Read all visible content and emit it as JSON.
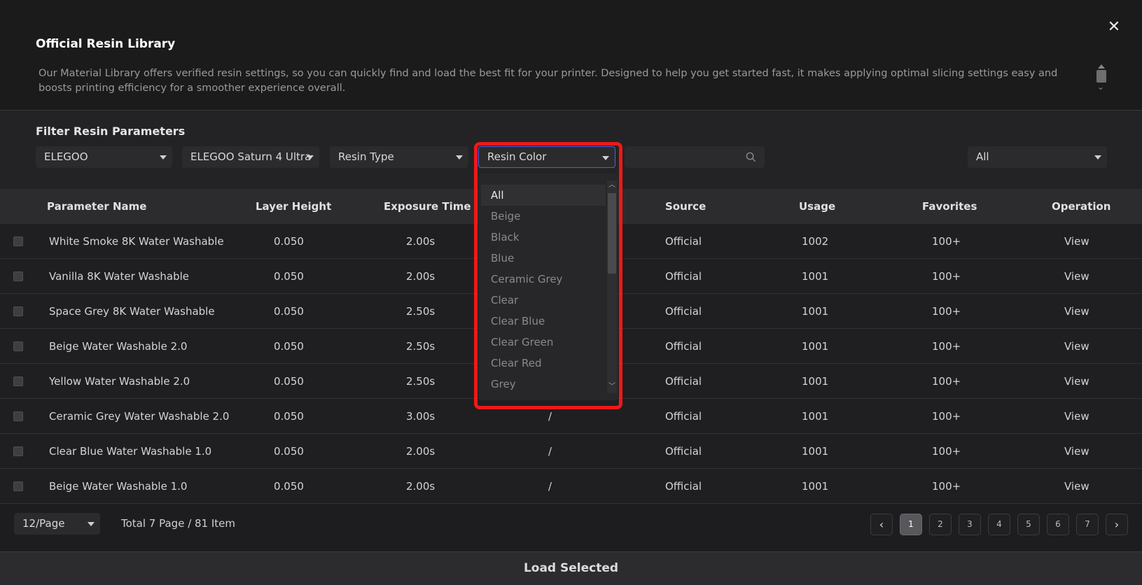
{
  "dialog": {
    "title": "Official Resin Library",
    "description": "Our Material Library offers verified resin settings, so you can quickly find and load the best fit for your printer. Designed to help you get started fast, it makes applying optimal slicing settings easy and boosts printing efficiency for a smoother experience overall.",
    "close_icon": "close-icon"
  },
  "filter": {
    "title": "Filter Resin Parameters",
    "brand": "ELEGOO",
    "printer": "ELEGOO Saturn 4 Ultra",
    "resin_type": "Resin Type",
    "resin_color": "Resin Color",
    "search_placeholder": "",
    "source": "All"
  },
  "table": {
    "headers": [
      "Parameter Name",
      "Layer Height",
      "Exposure Time",
      "",
      "Source",
      "Usage",
      "Favorites",
      "Operation"
    ],
    "rows": [
      {
        "name": "White Smoke 8K Water Washable",
        "layer": "0.050",
        "exposure": "2.00s",
        "extra": "",
        "source": "Official",
        "usage": "1002",
        "fav": "100+",
        "op": "View"
      },
      {
        "name": "Vanilla 8K Water Washable",
        "layer": "0.050",
        "exposure": "2.00s",
        "extra": "",
        "source": "Official",
        "usage": "1001",
        "fav": "100+",
        "op": "View"
      },
      {
        "name": "Space Grey 8K Water Washable",
        "layer": "0.050",
        "exposure": "2.50s",
        "extra": "",
        "source": "Official",
        "usage": "1001",
        "fav": "100+",
        "op": "View"
      },
      {
        "name": "Beige Water Washable 2.0",
        "layer": "0.050",
        "exposure": "2.50s",
        "extra": "",
        "source": "Official",
        "usage": "1001",
        "fav": "100+",
        "op": "View"
      },
      {
        "name": "Yellow Water Washable 2.0",
        "layer": "0.050",
        "exposure": "2.50s",
        "extra": "",
        "source": "Official",
        "usage": "1001",
        "fav": "100+",
        "op": "View"
      },
      {
        "name": "Ceramic Grey Water Washable 2.0",
        "layer": "0.050",
        "exposure": "3.00s",
        "extra": "/",
        "source": "Official",
        "usage": "1001",
        "fav": "100+",
        "op": "View"
      },
      {
        "name": "Clear Blue Water Washable 1.0",
        "layer": "0.050",
        "exposure": "2.00s",
        "extra": "/",
        "source": "Official",
        "usage": "1001",
        "fav": "100+",
        "op": "View"
      },
      {
        "name": "Beige Water Washable 1.0",
        "layer": "0.050",
        "exposure": "2.00s",
        "extra": "/",
        "source": "Official",
        "usage": "1001",
        "fav": "100+",
        "op": "View"
      }
    ]
  },
  "pagination": {
    "page_size": "12/Page",
    "total": "Total 7 Page / 81 Item",
    "pages": [
      "1",
      "2",
      "3",
      "4",
      "5",
      "6",
      "7"
    ],
    "current": "1",
    "prev": "‹",
    "next": "›"
  },
  "footer": {
    "load_label": "Load Selected"
  },
  "color_dropdown": {
    "options": [
      "All",
      "Beige",
      "Black",
      "Blue",
      "Ceramic Grey",
      "Clear",
      "Clear Blue",
      "Clear Green",
      "Clear Red",
      "Grey"
    ],
    "selected": "All"
  },
  "colors": {
    "accent_highlight": "#f01818",
    "active_border": "#5a5ad6"
  }
}
